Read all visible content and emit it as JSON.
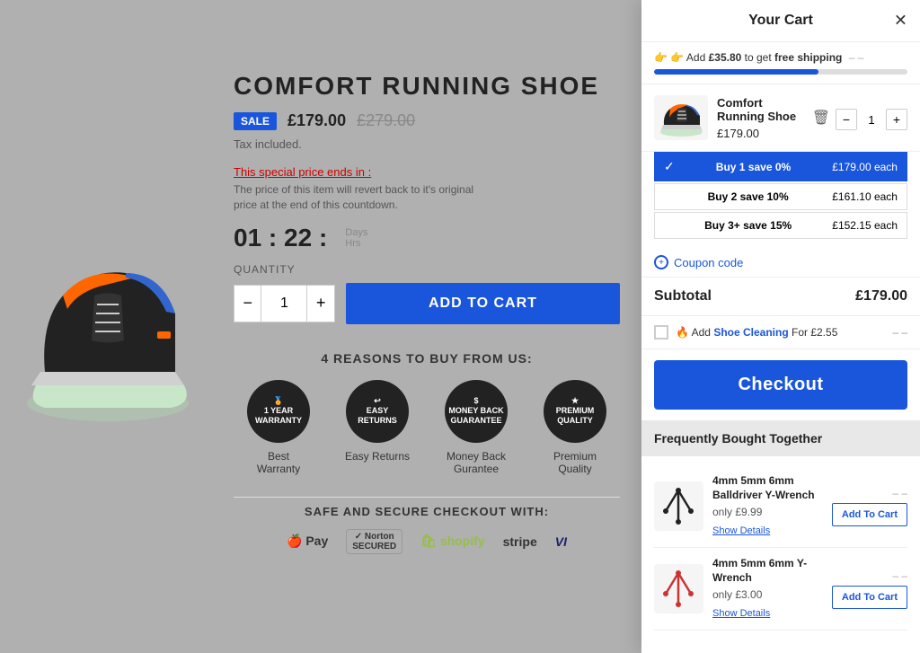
{
  "page": {
    "title": "Comfort Running Shoe"
  },
  "product": {
    "title": "COMFORT RUNNING SHOE",
    "sale_badge": "SALE",
    "sale_price": "£179.00",
    "original_price": "£279.00",
    "tax_note": "Tax included.",
    "special_price_label": "This special price ends in :",
    "special_price_note": "The price of this item will revert back to it's original price at the end of this countdown.",
    "countdown": "01 : 22 :",
    "countdown_days_label": "Days",
    "countdown_hrs_label": "Hrs",
    "quantity_label": "QUANTITY",
    "quantity_value": "1",
    "add_to_cart_label": "ADD TO CART"
  },
  "reasons": {
    "title": "4 REASONS TO BUY FROM US:",
    "items": [
      {
        "icon": "🏅",
        "label": "Best\nWarranty",
        "sublabel": "1 YEAR\nWARRANTY"
      },
      {
        "icon": "↩",
        "label": "Easy Returns",
        "sublabel": "EASY\nRETURNS"
      },
      {
        "icon": "$",
        "label": "Money Back\nGurantee",
        "sublabel": "MONEY BACK\nGUARANTEE"
      },
      {
        "icon": "★",
        "label": "Premium\nQuality",
        "sublabel": "PREMIUM\nQUALITY"
      }
    ]
  },
  "secure": {
    "title": "SAFE AND SECURE CHECKOUT WITH:",
    "icons": [
      "Apple Pay",
      "Norton SECURED",
      "shopify",
      "stripe",
      "VISA"
    ]
  },
  "cart": {
    "title": "Your Cart",
    "close_label": "✕",
    "shipping_text_prefix": "👉 Add ",
    "shipping_amount": "£35.80",
    "shipping_text_suffix": " to get ",
    "shipping_bold": "free shipping",
    "shipping_dash": "– –",
    "progress_percent": 65,
    "item": {
      "name": "Comfort Running Shoe",
      "price": "£179.00",
      "quantity": "1",
      "trash_icon": "🗑"
    },
    "tiers": [
      {
        "active": true,
        "check": "✓",
        "label": "Buy 1 save 0%",
        "price": "£179.00 each"
      },
      {
        "active": false,
        "check": "",
        "label": "Buy 2 save 10%",
        "price": "£161.10 each"
      },
      {
        "active": false,
        "check": "",
        "label": "Buy 3+ save 15%",
        "price": "£152.15 each"
      }
    ],
    "coupon_label": "Coupon code",
    "subtotal_label": "Subtotal",
    "subtotal_value": "£179.00",
    "upsell_fire": "🔥",
    "upsell_prefix": "Add ",
    "upsell_link": "Shoe Cleaning",
    "upsell_suffix": " For £2.55",
    "upsell_dash": "– –",
    "checkout_label": "Checkout",
    "fbt_title": "Frequently Bought Together",
    "fbt_items": [
      {
        "name": "4mm 5mm 6mm Balldriver Y-Wrench",
        "price": "only £9.99",
        "show_details": "Show Details",
        "add_label": "Add To Cart",
        "icon_color": "#222",
        "dash": "– –"
      },
      {
        "name": "4mm 5mm 6mm Y-Wrench",
        "price": "only £3.00",
        "show_details": "Show Details",
        "add_label": "Add To Cart",
        "icon_color": "#c44",
        "dash": "– –"
      }
    ]
  }
}
